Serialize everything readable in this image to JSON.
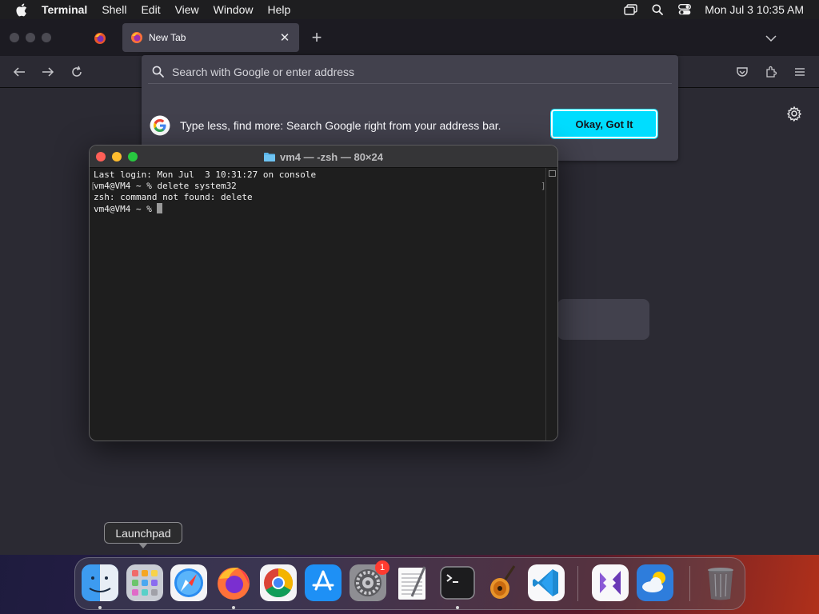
{
  "menubar": {
    "app_name": "Terminal",
    "items": [
      "Shell",
      "Edit",
      "View",
      "Window",
      "Help"
    ],
    "clock": "Mon Jul 3  10:35 AM"
  },
  "firefox": {
    "tab": {
      "label": "New Tab"
    },
    "urlbar": {
      "placeholder": "Search with Google or enter address",
      "tip_text": "Type less, find more: Search Google right from your address bar.",
      "tip_button": "Okay, Got It"
    }
  },
  "terminal": {
    "title": "vm4 — -zsh — 80×24",
    "lines": [
      "Last login: Mon Jul  3 10:31:27 on console",
      "vm4@VM4 ~ % delete system32",
      "zsh: command not found: delete",
      "vm4@VM4 ~ % "
    ]
  },
  "dock": {
    "tooltip": "Launchpad",
    "badge_count": "1",
    "apps": [
      "finder",
      "launchpad",
      "safari",
      "firefox",
      "chrome",
      "app-store",
      "system-settings",
      "textedit",
      "terminal",
      "garageband",
      "vscode",
      "visual-studio",
      "weather",
      "trash"
    ]
  },
  "colors": {
    "accent": "#00ddff",
    "terminal_bg": "#1e1e1e",
    "firefox_bg": "#2b2a33"
  }
}
